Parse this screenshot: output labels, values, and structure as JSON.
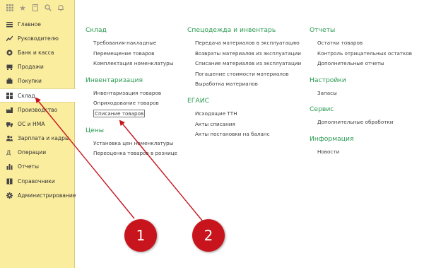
{
  "sidebar": {
    "items": [
      {
        "label": "Главное",
        "icon": "menu-icon"
      },
      {
        "label": "Руководителю",
        "icon": "chart-line-icon"
      },
      {
        "label": "Банк и касса",
        "icon": "coin-icon"
      },
      {
        "label": "Продажи",
        "icon": "cart-icon"
      },
      {
        "label": "Покупки",
        "icon": "bag-icon"
      },
      {
        "label": "Склад",
        "icon": "warehouse-icon"
      },
      {
        "label": "Производство",
        "icon": "factory-icon"
      },
      {
        "label": "ОС и НМА",
        "icon": "truck-icon"
      },
      {
        "label": "Зарплата и кадры",
        "icon": "people-icon"
      },
      {
        "label": "Операции",
        "icon": "operations-icon"
      },
      {
        "label": "Отчеты",
        "icon": "bar-chart-icon"
      },
      {
        "label": "Справочники",
        "icon": "book-icon"
      },
      {
        "label": "Администрирование",
        "icon": "gear-icon"
      }
    ],
    "active_index": 5
  },
  "columns": [
    {
      "groups": [
        {
          "title": "Склад",
          "links": [
            "Требования-накладные",
            "Перемещение товаров",
            "Комплектация номенклатуры"
          ]
        },
        {
          "title": "Инвентаризация",
          "links": [
            "Инвентаризация товаров",
            "Оприходование товаров",
            "Списание товаров"
          ]
        },
        {
          "title": "Цены",
          "links": [
            "Установка цен номенклатуры",
            "Переоценка товаров в рознице"
          ]
        }
      ]
    },
    {
      "groups": [
        {
          "title": "Спецодежда и инвентарь",
          "links": [
            "Передача материалов в эксплуатацию",
            "Возвраты материалов из эксплуатации",
            "Списание материалов из эксплуатации",
            "Погашение стоимости материалов",
            "Выработка материалов"
          ]
        },
        {
          "title": "ЕГАИС",
          "links": [
            "Исходящие ТТН",
            "Акты списания",
            "Акты постановки на баланс"
          ]
        }
      ]
    },
    {
      "groups": [
        {
          "title": "Отчеты",
          "links": [
            "Остатки товаров",
            "Контроль отрицательных остатков",
            "Дополнительные отчеты"
          ]
        },
        {
          "title": "Настройки",
          "links": [
            "Запасы"
          ]
        },
        {
          "title": "Сервис",
          "links": [
            "Дополнительные обработки"
          ]
        },
        {
          "title": "Информация",
          "links": [
            "Новости"
          ]
        }
      ]
    }
  ],
  "annotations": {
    "marker1": "1",
    "marker2": "2",
    "color": "#c8141c"
  },
  "colors": {
    "sidebar_bg": "#fbed9e",
    "group_title": "#2c9a52",
    "marker": "#c8141c"
  }
}
